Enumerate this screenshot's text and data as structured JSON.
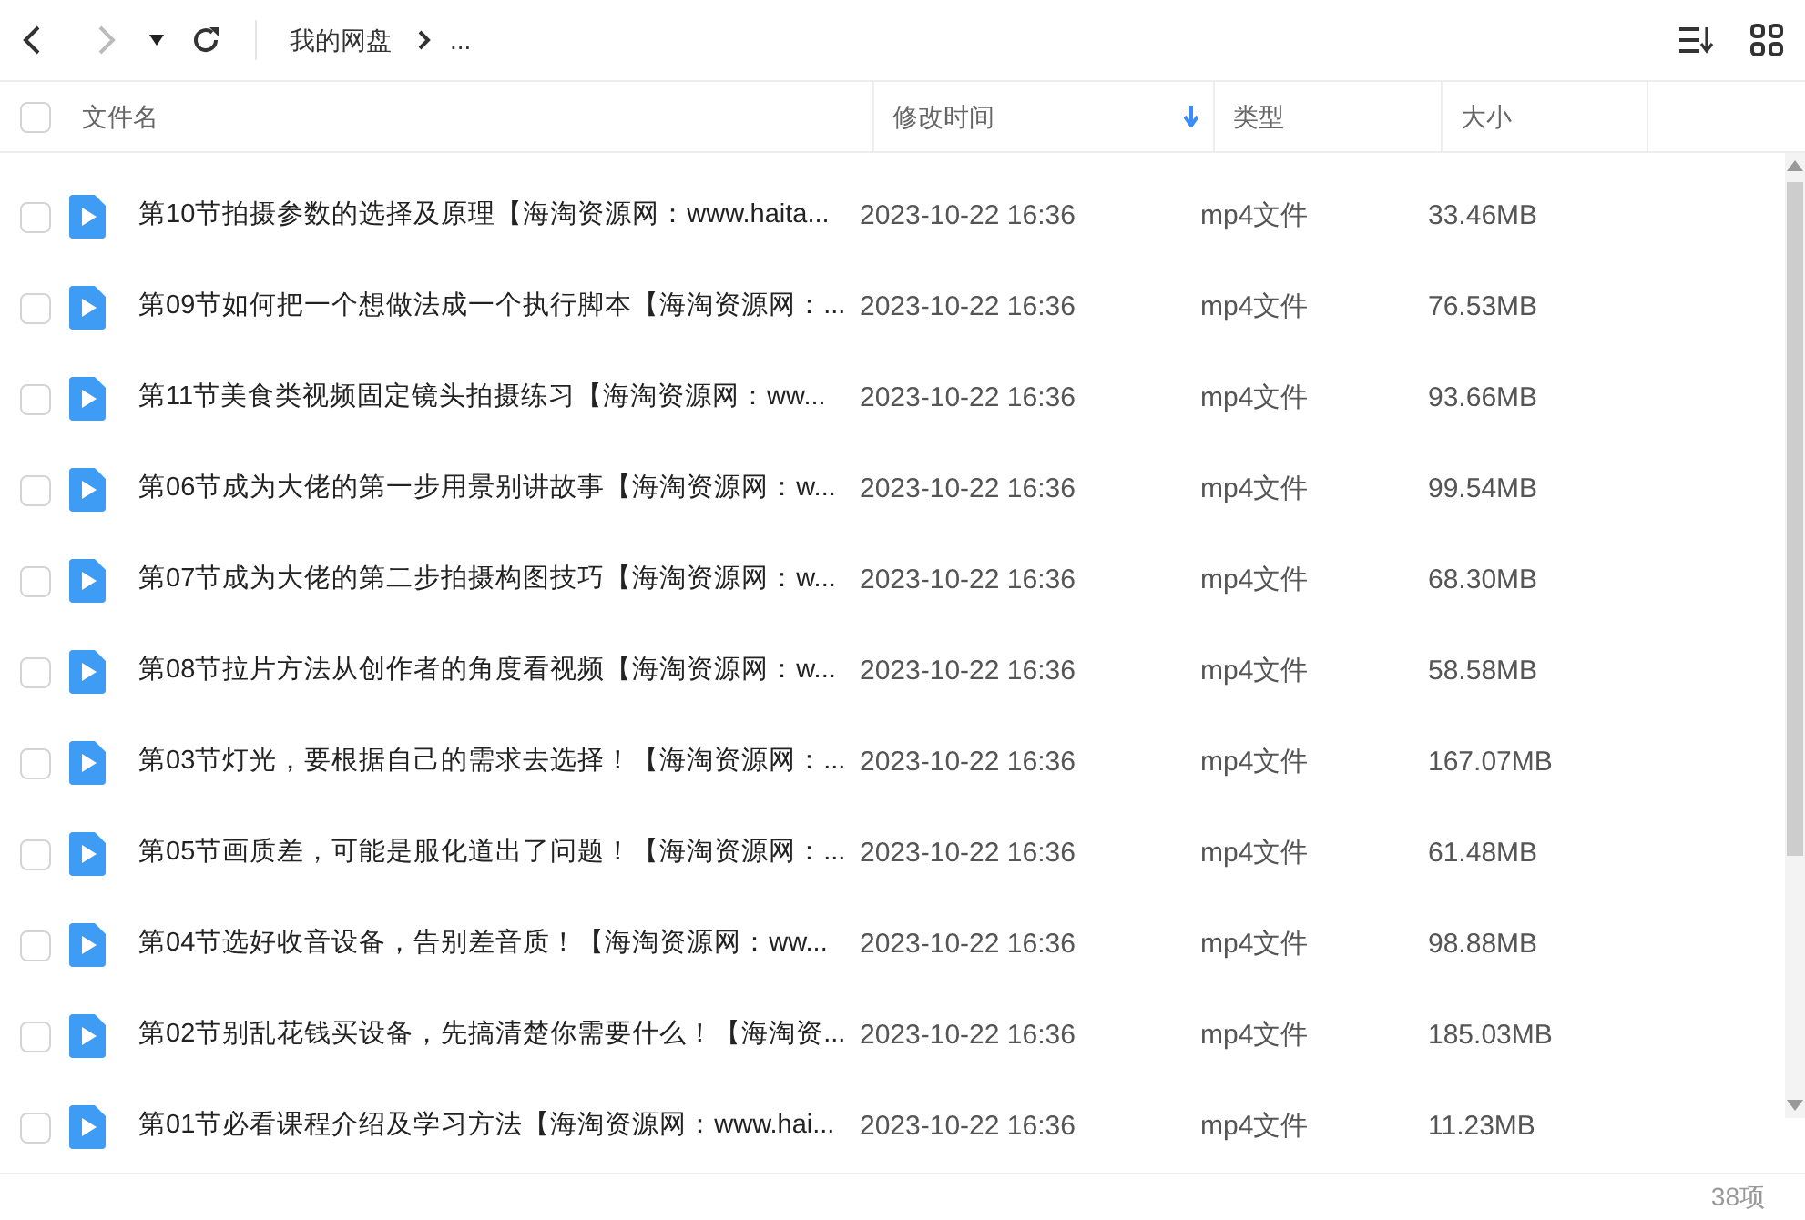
{
  "toolbar": {
    "breadcrumb": [
      {
        "label": "我的网盘"
      },
      {
        "label": "..."
      }
    ]
  },
  "table": {
    "select_all": {
      "checked": false
    },
    "columns": [
      {
        "label": "文件名",
        "sorted": false
      },
      {
        "label": "修改时间",
        "sorted": true
      },
      {
        "label": "类型",
        "sorted": false
      },
      {
        "label": "大小",
        "sorted": false
      }
    ],
    "rows": [
      {
        "name": "第10节拍摄参数的选择及原理【海淘资源网：www.haita...",
        "modified": "2023-10-22 16:36",
        "type": "mp4文件",
        "size": "33.46MB",
        "checked": false
      },
      {
        "name": "第09节如何把一个想做法成一个执行脚本【海淘资源网：...",
        "modified": "2023-10-22 16:36",
        "type": "mp4文件",
        "size": "76.53MB",
        "checked": false
      },
      {
        "name": "第11节美食类视频固定镜头拍摄练习【海淘资源网：ww...",
        "modified": "2023-10-22 16:36",
        "type": "mp4文件",
        "size": "93.66MB",
        "checked": false
      },
      {
        "name": "第06节成为大佬的第一步用景别讲故事【海淘资源网：w...",
        "modified": "2023-10-22 16:36",
        "type": "mp4文件",
        "size": "99.54MB",
        "checked": false
      },
      {
        "name": "第07节成为大佬的第二步拍摄构图技巧【海淘资源网：w...",
        "modified": "2023-10-22 16:36",
        "type": "mp4文件",
        "size": "68.30MB",
        "checked": false
      },
      {
        "name": "第08节拉片方法从创作者的角度看视频【海淘资源网：w...",
        "modified": "2023-10-22 16:36",
        "type": "mp4文件",
        "size": "58.58MB",
        "checked": false
      },
      {
        "name": "第03节灯光，要根据自己的需求去选择！【海淘资源网：...",
        "modified": "2023-10-22 16:36",
        "type": "mp4文件",
        "size": "167.07MB",
        "checked": false
      },
      {
        "name": "第05节画质差，可能是服化道出了问题！【海淘资源网：...",
        "modified": "2023-10-22 16:36",
        "type": "mp4文件",
        "size": "61.48MB",
        "checked": false
      },
      {
        "name": "第04节选好收音设备，告别差音质！【海淘资源网：ww...",
        "modified": "2023-10-22 16:36",
        "type": "mp4文件",
        "size": "98.88MB",
        "checked": false
      },
      {
        "name": "第02节别乱花钱买设备，先搞清楚你需要什么！【海淘资...",
        "modified": "2023-10-22 16:36",
        "type": "mp4文件",
        "size": "185.03MB",
        "checked": false
      },
      {
        "name": "第01节必看课程介绍及学习方法【海淘资源网：www.hai...",
        "modified": "2023-10-22 16:36",
        "type": "mp4文件",
        "size": "11.23MB",
        "checked": false
      }
    ]
  },
  "status_bar": {
    "count": "38项"
  }
}
